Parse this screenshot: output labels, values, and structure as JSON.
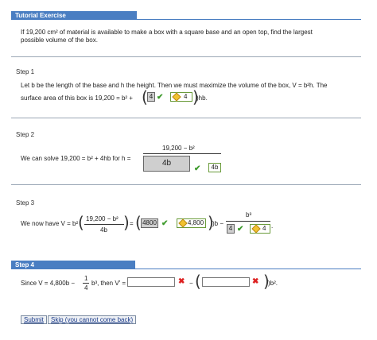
{
  "header": {
    "title": "Tutorial Exercise"
  },
  "problem": {
    "line1": "If 19,200 cm² of material is available to make a box with a square base and an open top, find the largest",
    "line2": "possible volume of the box."
  },
  "step1": {
    "label": "Step 1",
    "line1": "Let b be the length of the base and h the height. Then we must maximize the volume of the box, V = b²h. The",
    "line2_pre": "surface area of this box is 19,200 = b² +",
    "answer_gray": "4",
    "answer_box": "4",
    "suffix": ")hb."
  },
  "step2": {
    "label": "Step 2",
    "text": "We can solve 19,200 = b² + 4hb for h =",
    "numerator": "19,200 − b²",
    "gray_answer": "4b",
    "box_answer": "4b"
  },
  "step3": {
    "label": "Step 3",
    "text": "We now have V = b²",
    "frac_num": "19,200 − b²",
    "frac_den": "4b",
    "equals": "=",
    "gray1": "4800",
    "box1": "4,800",
    "mid": ")b −",
    "frac2_num": "b³",
    "gray2": "4",
    "box2": "4"
  },
  "step4": {
    "label": "Step 4",
    "text_pre": "Since V = 4,800b −",
    "frac_num": "1",
    "frac_den": "4",
    "text_post": "b³, then V′ =",
    "minus": "−",
    "tail": ")b².",
    "input1": "",
    "input2": ""
  },
  "buttons": {
    "submit": "Submit",
    "skip": "Skip (you cannot come back)"
  },
  "colors": {
    "accent": "#4a7ec2",
    "correct": "#3d9a2c",
    "wrong": "#dd2222"
  }
}
